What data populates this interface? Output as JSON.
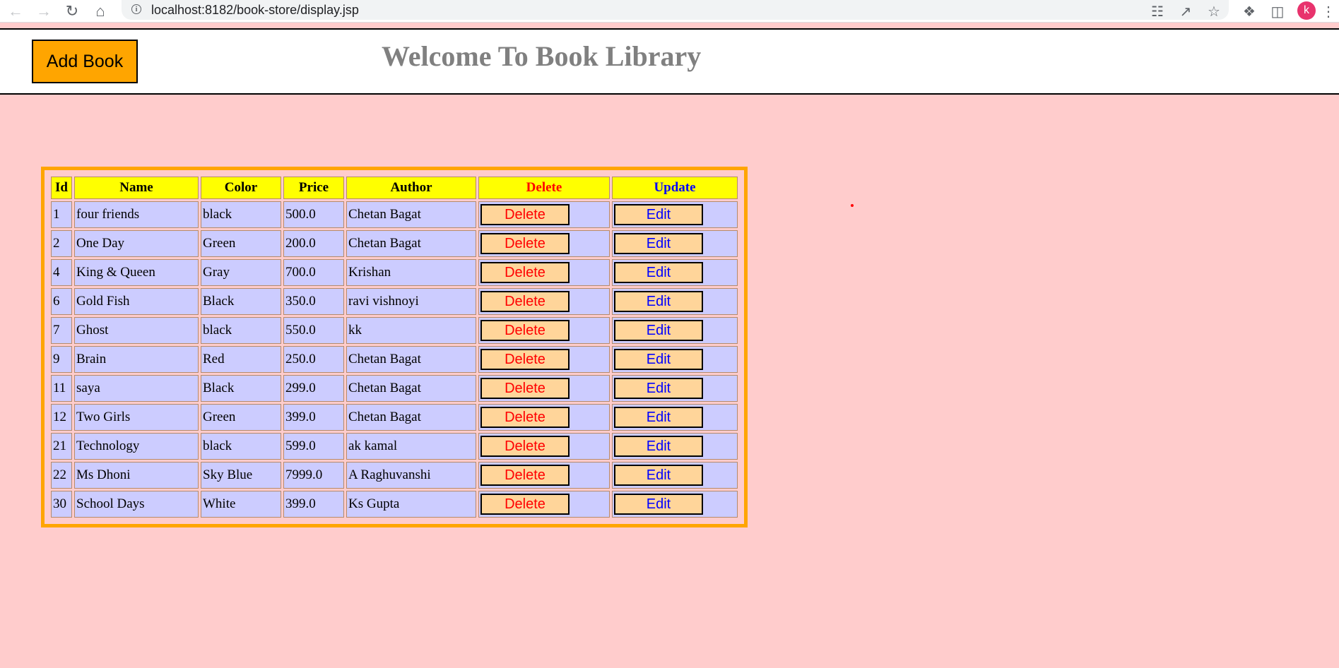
{
  "browser": {
    "url": "localhost:8182/book-store/display.jsp",
    "profile_initial": "k"
  },
  "header": {
    "add_book_label": "Add Book",
    "title": "Welcome To Book Library"
  },
  "table": {
    "columns": [
      "Id",
      "Name",
      "Color",
      "Price",
      "Author",
      "Delete",
      "Update"
    ],
    "delete_label": "Delete",
    "edit_label": "Edit",
    "rows": [
      {
        "id": "1",
        "name": "four friends",
        "color": "black",
        "price": "500.0",
        "author": "Chetan Bagat"
      },
      {
        "id": "2",
        "name": "One Day",
        "color": "Green",
        "price": "200.0",
        "author": "Chetan Bagat"
      },
      {
        "id": "4",
        "name": "King & Queen",
        "color": "Gray",
        "price": "700.0",
        "author": "Krishan"
      },
      {
        "id": "6",
        "name": "Gold Fish",
        "color": "Black",
        "price": "350.0",
        "author": "ravi vishnoyi"
      },
      {
        "id": "7",
        "name": "Ghost",
        "color": "black",
        "price": "550.0",
        "author": "kk"
      },
      {
        "id": "9",
        "name": "Brain",
        "color": "Red",
        "price": "250.0",
        "author": "Chetan Bagat"
      },
      {
        "id": "11",
        "name": "saya",
        "color": "Black",
        "price": "299.0",
        "author": "Chetan Bagat"
      },
      {
        "id": "12",
        "name": "Two Girls",
        "color": "Green",
        "price": "399.0",
        "author": "Chetan Bagat"
      },
      {
        "id": "21",
        "name": "Technology",
        "color": "black",
        "price": "599.0",
        "author": "ak kamal"
      },
      {
        "id": "22",
        "name": "Ms Dhoni",
        "color": "Sky Blue",
        "price": "7999.0",
        "author": "A Raghuvanshi"
      },
      {
        "id": "30",
        "name": "School Days",
        "color": "White",
        "price": "399.0",
        "author": "Ks Gupta"
      }
    ]
  },
  "colors": {
    "page_background": "#ffcccc",
    "header_cell": "#ffff00",
    "body_cell": "#ccccff",
    "table_border": "#ffa500",
    "add_button": "#ffa500",
    "action_button": "#ffd59a",
    "delete_text": "#ff0000",
    "edit_text": "#0000ff"
  }
}
